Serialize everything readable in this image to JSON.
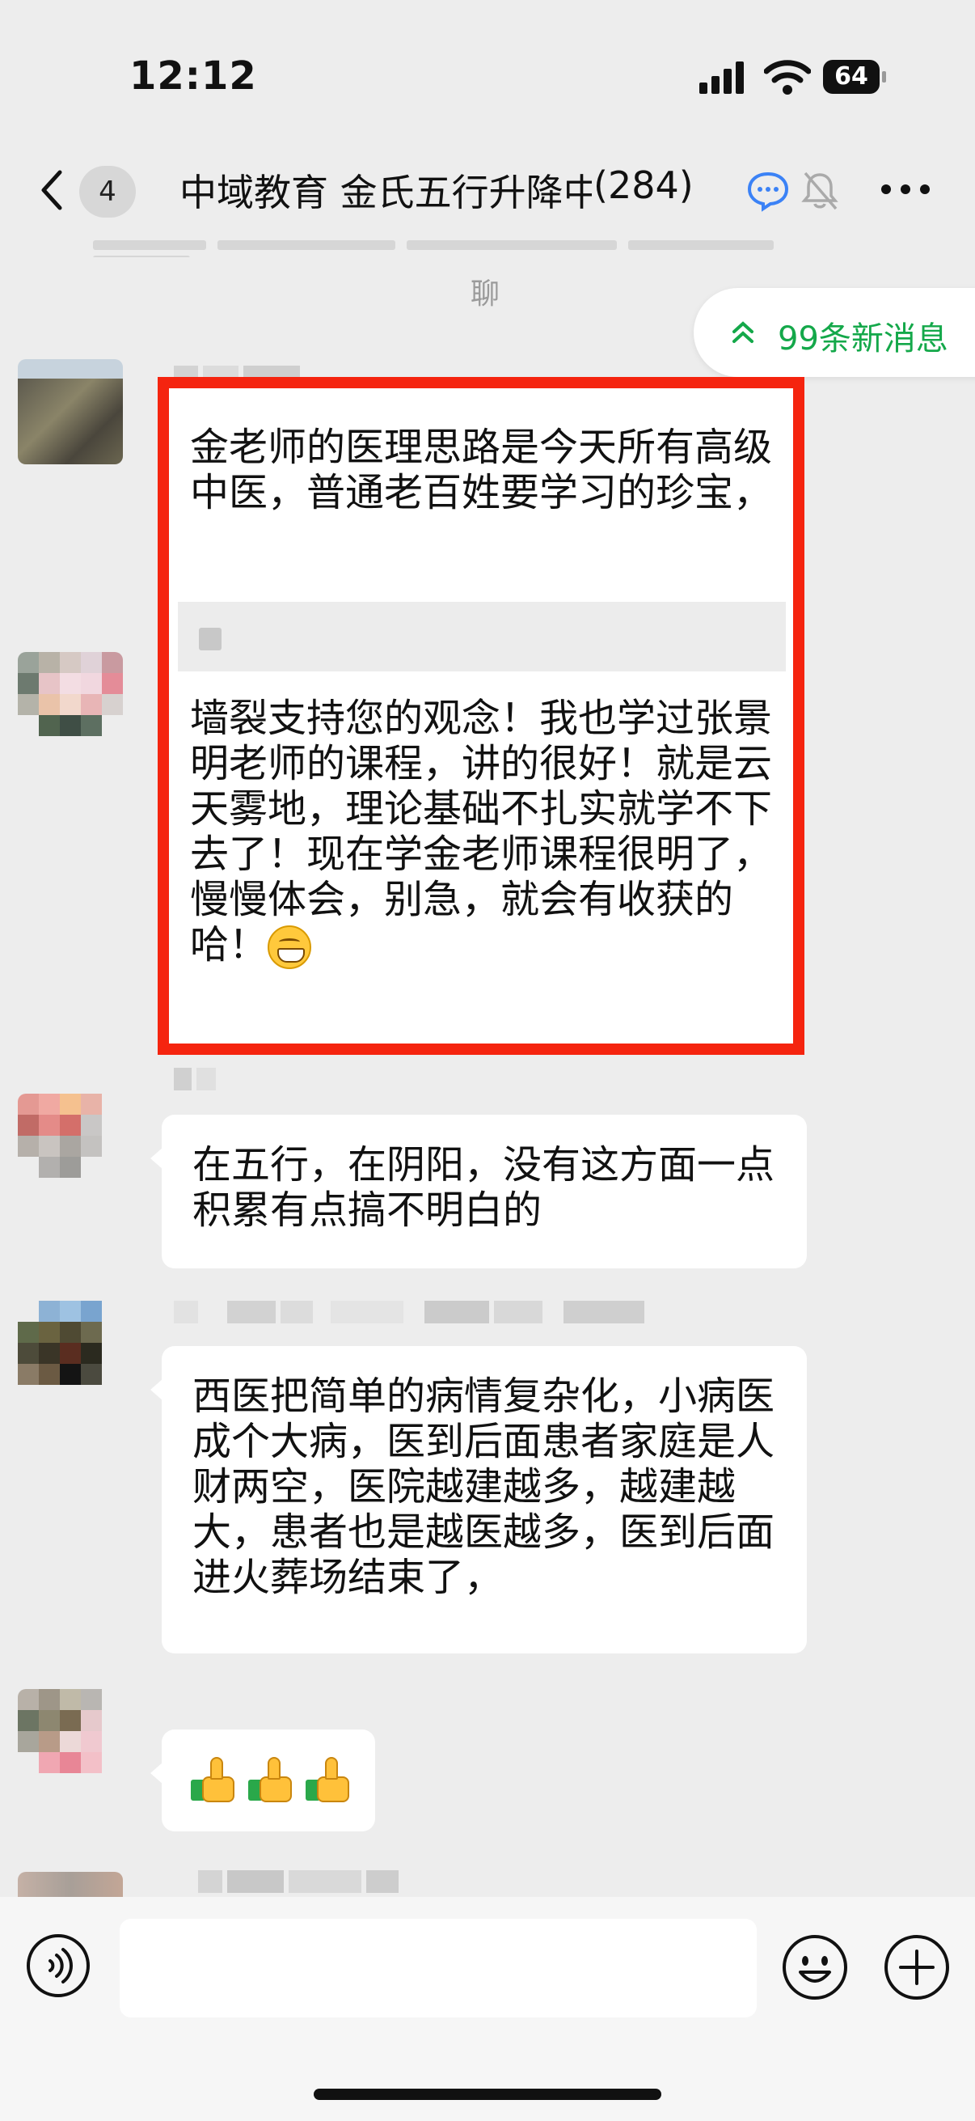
{
  "status_bar": {
    "time": "12:12",
    "battery": "64"
  },
  "nav": {
    "unread_count": "4",
    "title": "中域教育 金氏五行升降中",
    "member_count": "(284)"
  },
  "faded_partial_text": "聊",
  "new_messages_pill": "99条新消息",
  "messages": [
    {
      "quoted_text": "金老师的医理思路是今天所有高级中医，普通老百姓要学习的珍宝，",
      "reply_text": "墙裂支持您的观念！我也学过张景明老师的课程，讲的很好！就是云天雾地，理论基础不扎实就学不下去了！现在学金老师课程很明了，慢慢体会，别急，就会有收获的哈！",
      "emoji": "grinning-face"
    },
    {
      "text": "在五行，在阴阳，没有这方面一点积累有点搞不明白的"
    },
    {
      "text": "西医把简单的病情复杂化，小病医成个大病，医到后面患者家庭是人财两空，医院越建越多，越建越大，患者也是越医越多，医到后面进火葬场结束了，"
    },
    {
      "emoji_only": [
        "thumbs-up",
        "thumbs-up",
        "thumbs-up"
      ]
    }
  ],
  "input": {
    "placeholder": ""
  },
  "colors": {
    "highlight_frame": "#f5240f",
    "new_messages_green": "#14a84a",
    "background": "#ededed",
    "bubble": "#ffffff"
  }
}
